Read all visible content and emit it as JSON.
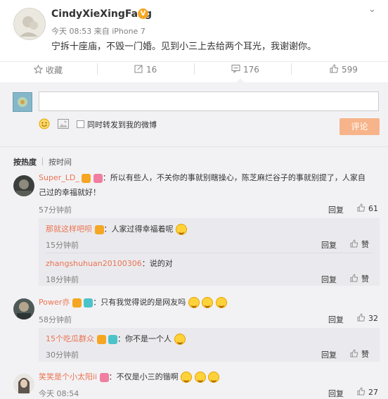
{
  "post": {
    "username": "CindyXieXingFang",
    "meta": "今天 08:53 来自 iPhone 7",
    "text": "宁拆十座庙，不毁一门婚。见到小三上去给两个耳光，我谢谢你。",
    "verified_color": "#f5a623"
  },
  "actions": {
    "favorite": "收藏",
    "repost": "16",
    "comment": "176",
    "like": "599"
  },
  "composer": {
    "input_placeholder": "",
    "repost_check_label": "同时转发到我的微博",
    "submit_label": "评论"
  },
  "sort": {
    "by_heat": "按热度",
    "by_time": "按时间"
  },
  "comments": [
    {
      "name": "Super_LD_",
      "text_line1": "：所以有些人，不关你的事就别瞎操心，陈芝麻烂谷子的事就别提了，人家自",
      "text_line2": "己过的幸福就好！",
      "time": "57分钟前",
      "reply": "回复",
      "likes": "61"
    },
    {
      "name": "那就这样吧呗",
      "text": "：人家过得幸福着呢",
      "time": "15分钟前",
      "reply": "回复",
      "likes": "赞"
    },
    {
      "name": "zhangshuhuan20100306",
      "text": "：说的对",
      "time": "18分钟前",
      "reply": "回复",
      "likes": "赞"
    },
    {
      "name": "Power亦",
      "text": "：只有我觉得说的是网友吗",
      "time": "58分钟前",
      "reply": "回复",
      "likes": "32"
    },
    {
      "name": "15个吃瓜群众",
      "text": "：你不是一个人",
      "time": "30分钟前",
      "reply": "回复",
      "likes": "赞"
    },
    {
      "name": "笑笑是个小太阳ii",
      "text": "：不仅是小三的锴啊",
      "time": "今天 08:54",
      "reply": "回复",
      "likes": "27"
    }
  ],
  "colors": {
    "accent": "#eb7350",
    "submit_bg": "#f7b48a",
    "panel_bg": "#f2f2f5"
  }
}
